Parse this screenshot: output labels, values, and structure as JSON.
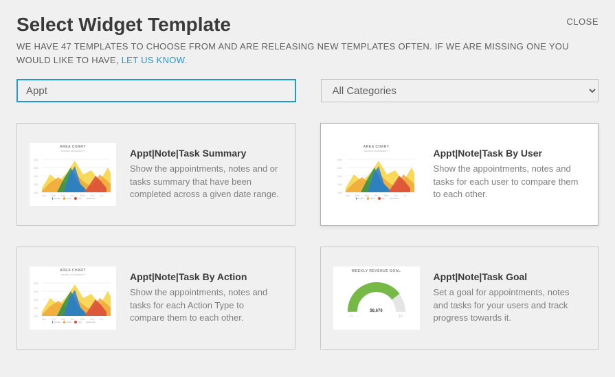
{
  "close_label": "CLOSE",
  "title": "Select Widget Template",
  "subtitle_part1": "WE HAVE 47 TEMPLATES TO CHOOSE FROM AND ARE RELEASING NEW TEMPLATES OFTEN. IF WE ARE MISSING ONE YOU WOULD LIKE TO HAVE, ",
  "subtitle_link": "LET US KNOW",
  "subtitle_part2": ".",
  "search_value": "Appt",
  "category_selected": "All Categories",
  "thumb_area_title": "AREA CHART",
  "thumb_area_sub": "SOURCE: INFOGRAPH™",
  "thumb_gauge_title": "WEEKLY REVENUE GOAL",
  "thumb_gauge_value": "$8,676",
  "cards": [
    {
      "title": "Appt|Note|Task Summary",
      "desc": "Show the appointments, notes and or tasks summary that have been completed across a given date range.",
      "thumb_type": "area",
      "selected": false
    },
    {
      "title": "Appt|Note|Task By User",
      "desc": "Show the appointments, notes and tasks for each user to compare them to each other.",
      "thumb_type": "area",
      "selected": true
    },
    {
      "title": "Appt|Note|Task By Action",
      "desc": "Show the appointments, notes and tasks for each Action Type to compare them to each other.",
      "thumb_type": "area",
      "selected": false
    },
    {
      "title": "Appt|Note|Task Goal",
      "desc": "Set a goal for appointments, notes and tasks for your users and track progress towards it.",
      "thumb_type": "gauge",
      "selected": false
    }
  ]
}
